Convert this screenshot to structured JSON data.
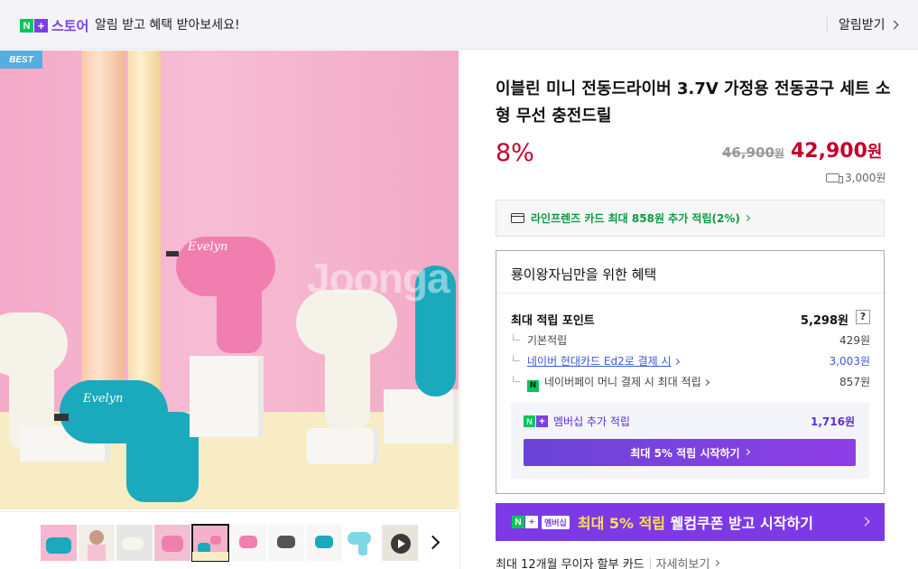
{
  "banner": {
    "logo_text": "스토어",
    "message": "알림 받고 혜택 받아보세요!",
    "alarm_button": "알림받기"
  },
  "gallery": {
    "badge": "BEST",
    "brand_text": "Evelyn",
    "watermark": "Joonga",
    "thumbnail_count": 10,
    "active_thumbnail": 5
  },
  "product": {
    "title": "이블린 미니 전동드라이버 3.7V 가정용 전동공구 세트 소형 무선 충전드릴",
    "discount": "8%",
    "original_price": "46,900",
    "sale_price": "42,900",
    "currency": "원",
    "shipping_fee": "3,000원"
  },
  "card_promo": "라인프렌즈 카드 최대 858원 추가 적립(2%)",
  "benefit": {
    "title": "룡이왕자님만을 위한 혜택",
    "max_points_label": "최대 적립 포인트",
    "max_points_value": "5,298원",
    "help": "?",
    "rows": [
      {
        "label": "기본적립",
        "value": "429원"
      },
      {
        "label": "네이버 현대카드 Ed2로 결제 시",
        "value": "3,003원"
      },
      {
        "label": "네이버페이 머니 결제 시 최대 적립",
        "value": "857원"
      }
    ],
    "npay_icon": "N",
    "membership_label": "멤버십 추가 적립",
    "membership_value": "1,716원",
    "membership_button": "최대 5% 적립 시작하기"
  },
  "coupon": {
    "tag": "멤버십",
    "text_highlight": "최대 5% 적립",
    "text_rest": " 웰컴쿠폰 받고 시작하기"
  },
  "installment": {
    "text": "최대 12개월 무이자 할부 카드",
    "more": "자세히보기"
  },
  "colors": {
    "brand_green": "#03c75a",
    "brand_purple": "#7b3fe4",
    "price_red": "#c4002b",
    "link_blue": "#3d5bd6"
  }
}
